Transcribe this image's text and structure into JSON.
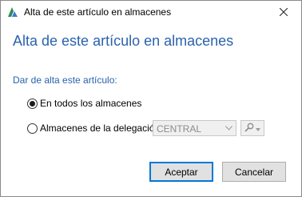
{
  "window": {
    "title": "Alta de este artículo en almacenes"
  },
  "dialog": {
    "heading": "Alta de este artículo en almacenes",
    "section_label": "Dar de alta este artículo:",
    "options": [
      {
        "label": "En todos los almacenes",
        "selected": true
      },
      {
        "label": "Almacenes de la delegación",
        "selected": false
      }
    ],
    "delegation_combo": {
      "value": "CENTRAL",
      "enabled": false
    },
    "buttons": {
      "accept": "Aceptar",
      "cancel": "Cancelar"
    }
  },
  "colors": {
    "heading": "#2a62ad",
    "default_button_border": "#0078d7",
    "disabled_text": "#8c8c8c"
  },
  "icons": {
    "app": "app-logo-icon",
    "close": "close-icon",
    "combo": "chevron-down-icon",
    "search": "magnifier-icon"
  }
}
